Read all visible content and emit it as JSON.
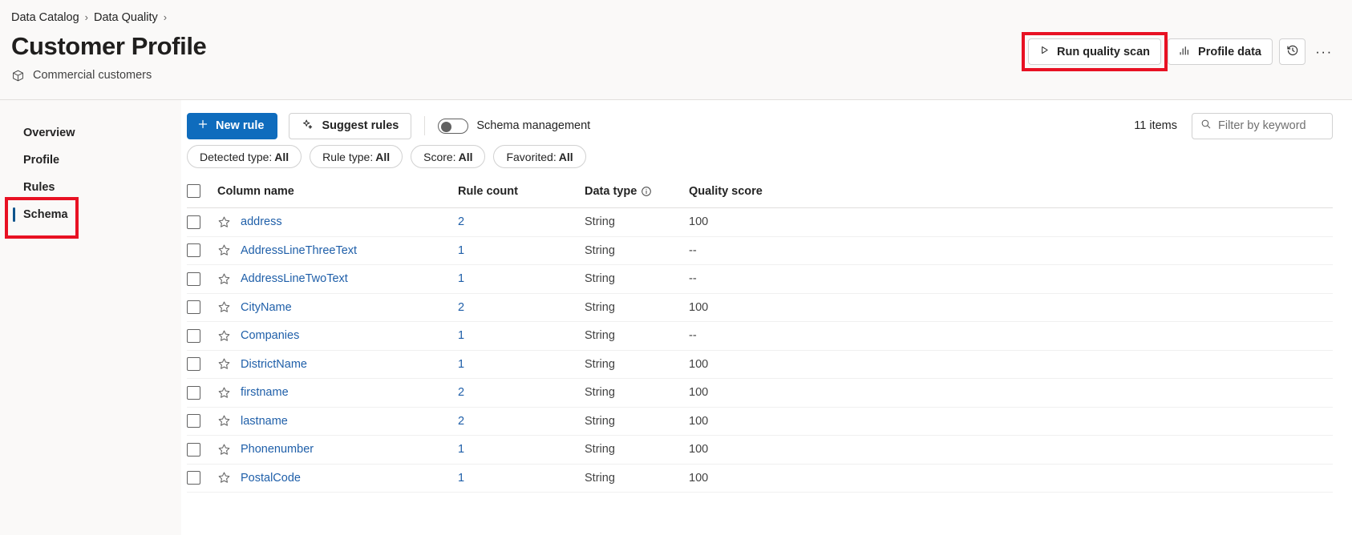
{
  "breadcrumb": {
    "items": [
      {
        "label": "Data Catalog"
      },
      {
        "label": "Data Quality"
      }
    ],
    "separator": "›"
  },
  "header": {
    "title": "Customer Profile",
    "subtitle": "Commercial customers",
    "subtitle_icon": "cube-icon"
  },
  "toolbar": {
    "run_scan_label": "Run quality scan",
    "run_scan_icon": "play-icon",
    "profile_data_label": "Profile data",
    "profile_data_icon": "bar-chart-icon",
    "history_icon": "history-clock-icon",
    "overflow_label": "···",
    "highlight_color": "#e81123"
  },
  "sidebar": {
    "items": [
      {
        "label": "Overview",
        "selected": false
      },
      {
        "label": "Profile",
        "selected": false
      },
      {
        "label": "Rules",
        "selected": false
      },
      {
        "label": "Schema",
        "selected": true
      }
    ]
  },
  "action_bar": {
    "new_rule_label": "New rule",
    "new_rule_icon": "plus-icon",
    "suggest_rules_label": "Suggest rules",
    "suggest_rules_icon": "sparkle-icon",
    "schema_management_label": "Schema management",
    "schema_management_on": false,
    "items_count": "11 items",
    "search_placeholder": "Filter by keyword",
    "search_value": "",
    "search_icon": "search-icon"
  },
  "filters": [
    {
      "label": "Detected type:",
      "value": "All"
    },
    {
      "label": "Rule type:",
      "value": "All"
    },
    {
      "label": "Score:",
      "value": "All"
    },
    {
      "label": "Favorited:",
      "value": "All"
    }
  ],
  "table": {
    "columns": [
      {
        "key": "select",
        "label": ""
      },
      {
        "key": "column_name",
        "label": "Column name"
      },
      {
        "key": "rule_count",
        "label": "Rule count"
      },
      {
        "key": "data_type",
        "label": "Data type",
        "info_icon": "info-icon"
      },
      {
        "key": "quality_score",
        "label": "Quality score"
      }
    ],
    "rows": [
      {
        "column_name": "address",
        "rule_count": "2",
        "data_type": "String",
        "quality_score": "100"
      },
      {
        "column_name": "AddressLineThreeText",
        "rule_count": "1",
        "data_type": "String",
        "quality_score": "--"
      },
      {
        "column_name": "AddressLineTwoText",
        "rule_count": "1",
        "data_type": "String",
        "quality_score": "--"
      },
      {
        "column_name": "CityName",
        "rule_count": "2",
        "data_type": "String",
        "quality_score": "100"
      },
      {
        "column_name": "Companies",
        "rule_count": "1",
        "data_type": "String",
        "quality_score": "--"
      },
      {
        "column_name": "DistrictName",
        "rule_count": "1",
        "data_type": "String",
        "quality_score": "100"
      },
      {
        "column_name": "firstname",
        "rule_count": "2",
        "data_type": "String",
        "quality_score": "100"
      },
      {
        "column_name": "lastname",
        "rule_count": "2",
        "data_type": "String",
        "quality_score": "100"
      },
      {
        "column_name": "Phonenumber",
        "rule_count": "1",
        "data_type": "String",
        "quality_score": "100"
      },
      {
        "column_name": "PostalCode",
        "rule_count": "1",
        "data_type": "String",
        "quality_score": "100"
      }
    ]
  },
  "colors": {
    "primary": "#0f6cbd",
    "link": "#1f5fa9",
    "accent_bar": "#0f548c",
    "annotation": "#e81123",
    "page_bg": "#faf9f8"
  }
}
